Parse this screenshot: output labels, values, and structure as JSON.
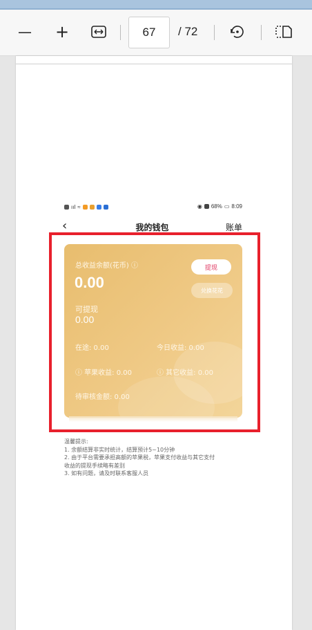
{
  "toolbar": {
    "zoom_out": "—",
    "zoom_in": "+",
    "current_page": "67",
    "total_pages": "/ 72"
  },
  "phone": {
    "status_right": "68%",
    "time": "8:09",
    "nav_title": "我的钱包",
    "nav_back": "‹",
    "nav_bill": "账单"
  },
  "wallet": {
    "total_label": "总收益余额(花币) ⓘ",
    "total_value": "0.00",
    "withdrawable_label": "可提现",
    "withdrawable_value": "0.00",
    "withdraw_button": "提现",
    "exchange_button": "兑换花花",
    "in_transit": "在途: 0.00",
    "today_income": "今日收益: 0.00",
    "apple_income": "ⓘ 苹果收益: 0.00",
    "other_income": "ⓘ 其它收益: 0.00",
    "pending_review": "待审核金额: 0.00"
  },
  "tips": {
    "title": "温馨提示:",
    "line1": "1. 余额结算非实时统计，结算预计5~10分钟",
    "line2": "2. 由于平台需要承担高额的苹果税，苹果支付收益与其它支付",
    "line3": "收益的提现手续略有差别",
    "line4": "3. 如有问题，请及时联系客服人员"
  },
  "colors": {
    "highlight": "#e8202c",
    "card_gold": "#efc985",
    "withdraw_text": "#e03a63"
  }
}
